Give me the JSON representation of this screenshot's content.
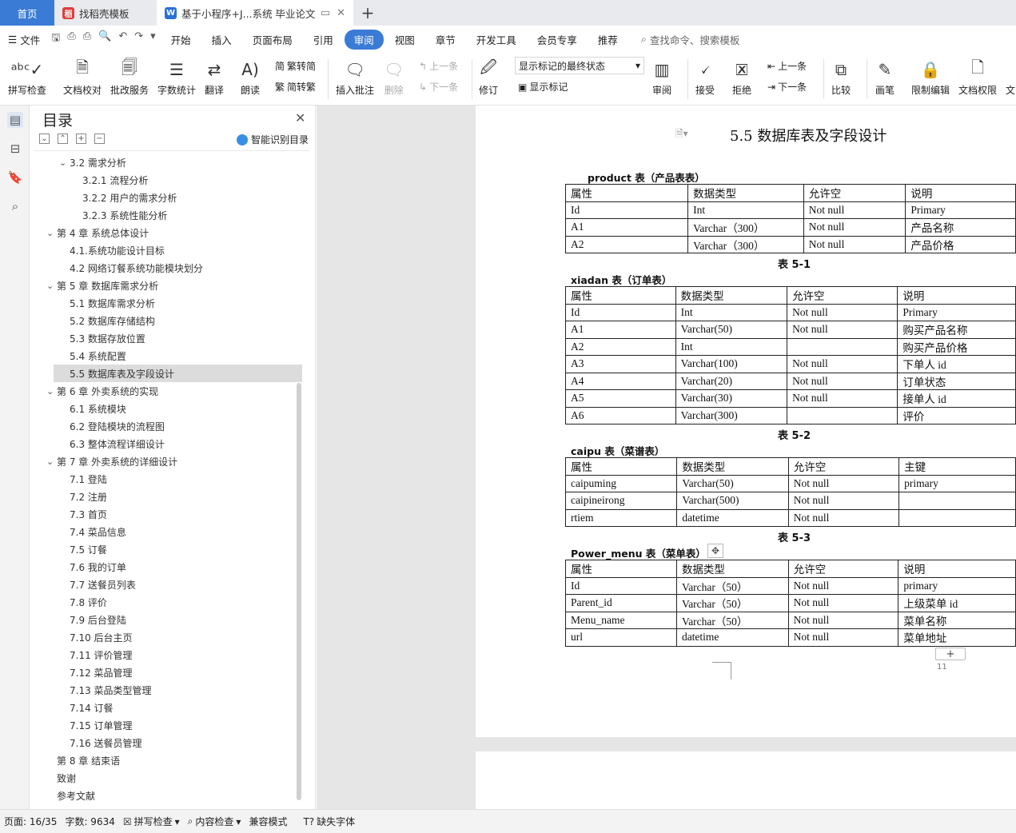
{
  "tabs": {
    "home": "首页",
    "template": "找稻壳模板",
    "doc": "基于小程序+J...系统 毕业论文"
  },
  "menu": {
    "file": "文件",
    "items": [
      "开始",
      "插入",
      "页面布局",
      "引用",
      "审阅",
      "视图",
      "章节",
      "开发工具",
      "会员专享",
      "推荐"
    ],
    "active_index": 4,
    "search": "查找命令、搜索模板"
  },
  "ribbon": {
    "spell": "拼写检查",
    "proof": "文档校对",
    "correction": "批改服务",
    "wordcount": "字数统计",
    "translate": "翻译",
    "read": "朗读",
    "to_trad": "繁转简",
    "to_simp": "简转繁",
    "insert_comment": "插入批注",
    "delete": "删除",
    "prev_comment": "上一条",
    "next_comment": "下一条",
    "revise": "修订",
    "markup_state": "显示标记的最终状态",
    "show_markup": "显示标记",
    "review": "审阅",
    "accept": "接受",
    "reject": "拒绝",
    "prev": "上一条",
    "next": "下一条",
    "compare": "比较",
    "pen": "画笔",
    "restrict": "限制编辑",
    "doc_rights": "文档权限",
    "more": "文"
  },
  "toc": {
    "title": "目录",
    "smart": "智能识别目录",
    "items": [
      {
        "t": "3.2 需求分析",
        "lvl": 2,
        "arrow": true
      },
      {
        "t": "3.2.1 流程分析",
        "lvl": 3
      },
      {
        "t": "3.2.2 用户的需求分析",
        "lvl": 3
      },
      {
        "t": "3.2.3 系统性能分析",
        "lvl": 3
      },
      {
        "t": "第 4 章  系统总体设计",
        "lvl": 1,
        "arrow": true
      },
      {
        "t": "4.1.系统功能设计目标",
        "lvl": 2
      },
      {
        "t": "4.2  网络订餐系统功能模块划分",
        "lvl": 2
      },
      {
        "t": "第 5 章  数据库需求分析",
        "lvl": 1,
        "arrow": true
      },
      {
        "t": "5.1 数据库需求分析",
        "lvl": 2
      },
      {
        "t": "5.2 数据库存储结构",
        "lvl": 2
      },
      {
        "t": "5.3  数据存放位置",
        "lvl": 2
      },
      {
        "t": "5.4  系统配置",
        "lvl": 2
      },
      {
        "t": "5.5 数据库表及字段设计",
        "lvl": 2,
        "sel": true
      },
      {
        "t": "第 6 章  外卖系统的实现",
        "lvl": 1,
        "arrow": true
      },
      {
        "t": "6.1 系统模块",
        "lvl": 2
      },
      {
        "t": "6.2  登陆模块的流程图",
        "lvl": 2
      },
      {
        "t": "6.3  整体流程详细设计",
        "lvl": 2
      },
      {
        "t": "第 7 章  外卖系统的详细设计",
        "lvl": 1,
        "arrow": true
      },
      {
        "t": "7.1 登陆",
        "lvl": 2
      },
      {
        "t": "7.2 注册",
        "lvl": 2
      },
      {
        "t": "7.3 首页",
        "lvl": 2
      },
      {
        "t": "7.4 菜品信息",
        "lvl": 2
      },
      {
        "t": "7.5 订餐",
        "lvl": 2
      },
      {
        "t": "7.6 我的订单",
        "lvl": 2
      },
      {
        "t": "7.7 送餐员列表",
        "lvl": 2
      },
      {
        "t": "7.8 评价",
        "lvl": 2
      },
      {
        "t": "7.9  后台登陆",
        "lvl": 2
      },
      {
        "t": "7.10  后台主页",
        "lvl": 2
      },
      {
        "t": "7.11 评价管理",
        "lvl": 2
      },
      {
        "t": "7.12 菜品管理",
        "lvl": 2
      },
      {
        "t": "7.13 菜品类型管理",
        "lvl": 2
      },
      {
        "t": "7.14 订餐",
        "lvl": 2
      },
      {
        "t": "7.15 订单管理",
        "lvl": 2
      },
      {
        "t": "7.16 送餐员管理",
        "lvl": 2
      },
      {
        "t": "第 8 章  结束语",
        "lvl": 1
      },
      {
        "t": "致谢",
        "lvl": 1
      },
      {
        "t": "参考文献",
        "lvl": 1
      }
    ]
  },
  "doc": {
    "heading": "5.5 数据库表及字段设计",
    "page_number": "11",
    "add_row": "+",
    "tables": [
      {
        "title": "product 表（产品表表）",
        "caption": "表 5-1",
        "rows": [
          [
            "属性",
            "数据类型",
            "允许空",
            "说明"
          ],
          [
            "Id",
            "Int",
            "Not null",
            "Primary"
          ],
          [
            "A1",
            "Varchar（300）",
            "Not null",
            "产品名称"
          ],
          [
            "A2",
            "Varchar（300）",
            "Not null",
            "产品价格"
          ]
        ]
      },
      {
        "title": "xiadan 表（订单表）",
        "caption": "表 5-2",
        "rows": [
          [
            "属性",
            "数据类型",
            "允许空",
            "说明"
          ],
          [
            "Id",
            "Int",
            "Not null",
            "Primary"
          ],
          [
            "A1",
            "Varchar(50)",
            "Not null",
            "购买产品名称"
          ],
          [
            "A2",
            "Int",
            "",
            "购买产品价格"
          ],
          [
            "A3",
            "Varchar(100)",
            "Not null",
            "下单人 id"
          ],
          [
            "A4",
            "Varchar(20)",
            "Not null",
            "订单状态"
          ],
          [
            "A5",
            "Varchar(30)",
            "Not null",
            "接单人 id"
          ],
          [
            "A6",
            "Varchar(300)",
            "",
            "评价"
          ]
        ]
      },
      {
        "title": "caipu 表（菜谱表）",
        "caption": "表 5-3",
        "rows": [
          [
            "属性",
            "数据类型",
            "允许空",
            "主键"
          ],
          [
            "caipuming",
            "Varchar(50)",
            "Not null",
            "primary"
          ],
          [
            "caipineirong",
            "Varchar(500)",
            "Not null",
            ""
          ],
          [
            "rtiem",
            "datetime",
            "Not null",
            ""
          ]
        ]
      },
      {
        "title": "Power_menu 表（菜单表）",
        "caption": "",
        "rows": [
          [
            "属性",
            "数据类型",
            "允许空",
            "说明"
          ],
          [
            "Id",
            "Varchar（50）",
            "Not null",
            "primary"
          ],
          [
            "Parent_id",
            "Varchar（50）",
            "Not null",
            "上级菜单 id"
          ],
          [
            "Menu_name",
            "Varchar（50）",
            "Not null",
            "菜单名称"
          ],
          [
            "url",
            "datetime",
            "Not null",
            "菜单地址"
          ]
        ]
      }
    ]
  },
  "status": {
    "page": "页面: 16/35",
    "words": "字数: 9634",
    "spell": "拼写检查",
    "content": "内容检查",
    "compat": "兼容模式",
    "missing_font": "缺失字体"
  }
}
